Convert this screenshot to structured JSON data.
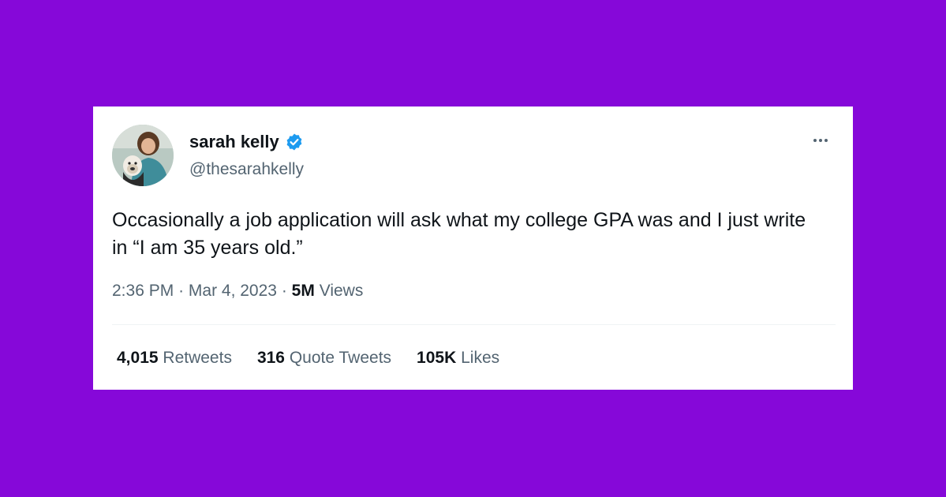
{
  "colors": {
    "background": "#8608d9",
    "card": "#ffffff",
    "verified": "#1d9bf0",
    "text_primary": "#0f1419",
    "text_secondary": "#536471"
  },
  "author": {
    "display_name": "sarah kelly",
    "handle": "@thesarahkelly",
    "verified_icon": "verified-badge-icon",
    "avatar_icon": "avatar"
  },
  "tweet": {
    "text": "Occasionally a job application will ask what my college GPA was and I just write in “I am 35 years old.”",
    "time": "2:36 PM",
    "separator": "·",
    "date": "Mar 4, 2023",
    "views_count": "5M",
    "views_label": "Views"
  },
  "stats": {
    "retweets_count": "4,015",
    "retweets_label": "Retweets",
    "quotes_count": "316",
    "quotes_label": "Quote Tweets",
    "likes_count": "105K",
    "likes_label": "Likes"
  },
  "menu_icon": "more-options-icon"
}
